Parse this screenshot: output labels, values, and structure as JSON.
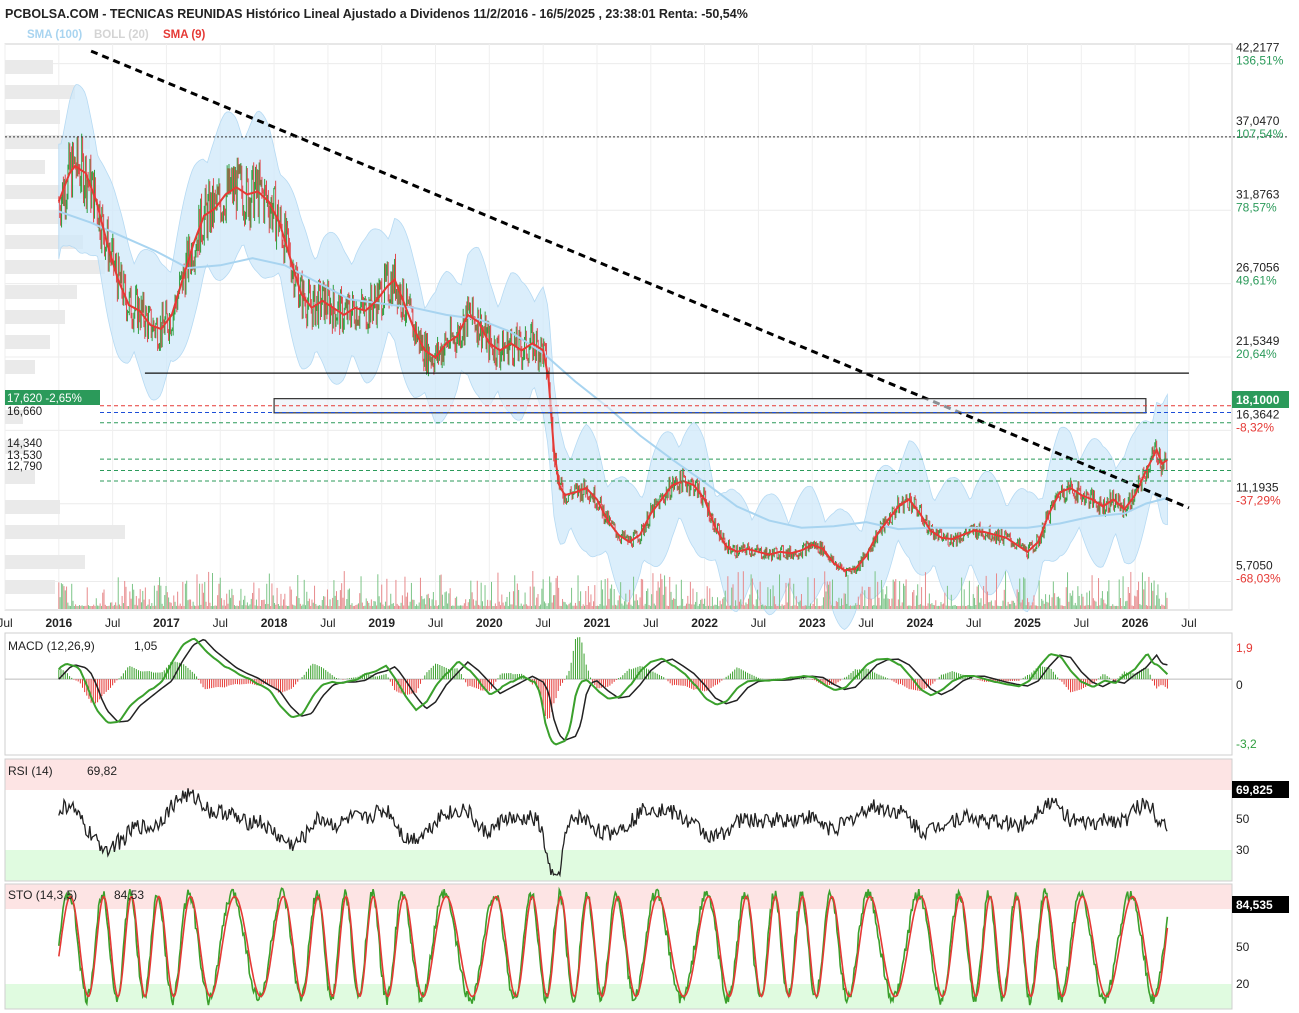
{
  "header": {
    "title": "PCBOLSA.COM - TECNICAS REUNIDAS Histórico Lineal Ajustado a Dividenos 11/2/2016 - 16/5/2025 , 23:38:01 Renta: -50,54%",
    "legend": [
      {
        "label": "SMA (100)",
        "color": "#a8d4f0"
      },
      {
        "label": "BOLL (20)",
        "color": "#d8d8d8"
      },
      {
        "label": "SMA (9)",
        "color": "#e53935"
      }
    ]
  },
  "colors": {
    "price_up": "#2e9e3e",
    "price_down": "#e0474c",
    "sma9": "#e53935",
    "sma100": "#a8d4f0",
    "boll_fill": "#cfe8fa",
    "trendline": "#000000",
    "green_label": "#2b9a5a",
    "red_label": "#e53935",
    "rsi_line": "#222222",
    "sto_k": "#3aa02c",
    "sto_d": "#e53935",
    "overbought": "#fde4e4",
    "oversold": "#e0fbe0"
  },
  "chart_data": [
    {
      "type": "line",
      "panel": "price",
      "x_tick_labels": [
        "Jul",
        "2016",
        "Jul",
        "2017",
        "Jul",
        "2018",
        "Jul",
        "2019",
        "Jul",
        "2020",
        "Jul",
        "2021",
        "Jul",
        "2022",
        "Jul",
        "2023",
        "Jul",
        "2024",
        "Jul",
        "2025",
        "Jul",
        "2026",
        "Jul"
      ],
      "y_axis_levels": [
        {
          "value": "42,2177",
          "pct": "136,51%",
          "pct_color": "green"
        },
        {
          "value": "37,0470",
          "pct": "107,54%",
          "pct_color": "green"
        },
        {
          "value": "31,8763",
          "pct": "78,57%",
          "pct_color": "green"
        },
        {
          "value": "26,7056",
          "pct": "49,61%",
          "pct_color": "green"
        },
        {
          "value": "21,5349",
          "pct": "20,64%",
          "pct_color": "green"
        },
        {
          "value": "16,3642",
          "pct": "-8,32%",
          "pct_color": "red"
        },
        {
          "value": "11,1935",
          "pct": "-37,29%",
          "pct_color": "red"
        },
        {
          "value": "5,7050",
          "pct": "-68,03%",
          "pct_color": "red"
        }
      ],
      "last_price": "18,1000",
      "left_labels": {
        "current": "17,620  -2,65%",
        "levels": [
          "16,660",
          "14,340",
          "13,530",
          "12,790"
        ]
      },
      "ylim": [
        3.7,
        43.6
      ],
      "series": [
        {
          "name": "SMA (9)",
          "values": [
            [
              2016.0,
              32.5
            ],
            [
              2016.05,
              33.5
            ],
            [
              2016.1,
              34.5
            ],
            [
              2016.15,
              35.0
            ],
            [
              2016.25,
              34.5
            ],
            [
              2016.35,
              32.5
            ],
            [
              2016.45,
              29.5
            ],
            [
              2016.55,
              27.0
            ],
            [
              2016.65,
              25.2
            ],
            [
              2016.75,
              24.8
            ],
            [
              2016.85,
              23.8
            ],
            [
              2016.95,
              23.5
            ],
            [
              2017.05,
              24.5
            ],
            [
              2017.15,
              27.0
            ],
            [
              2017.25,
              29.5
            ],
            [
              2017.35,
              31.5
            ],
            [
              2017.45,
              32.0
            ],
            [
              2017.55,
              33.0
            ],
            [
              2017.65,
              33.5
            ],
            [
              2017.75,
              33.0
            ],
            [
              2017.85,
              33.2
            ],
            [
              2017.95,
              32.5
            ],
            [
              2018.05,
              31.0
            ],
            [
              2018.15,
              28.5
            ],
            [
              2018.25,
              26.0
            ],
            [
              2018.35,
              25.0
            ],
            [
              2018.45,
              25.5
            ],
            [
              2018.55,
              25.0
            ],
            [
              2018.65,
              24.5
            ],
            [
              2018.75,
              25.0
            ],
            [
              2018.85,
              24.8
            ],
            [
              2018.95,
              25.5
            ],
            [
              2019.05,
              26.5
            ],
            [
              2019.12,
              27.0
            ],
            [
              2019.2,
              25.5
            ],
            [
              2019.3,
              23.5
            ],
            [
              2019.4,
              22.0
            ],
            [
              2019.5,
              21.5
            ],
            [
              2019.6,
              22.5
            ],
            [
              2019.7,
              23.0
            ],
            [
              2019.8,
              24.5
            ],
            [
              2019.9,
              24.0
            ],
            [
              2020.0,
              22.5
            ],
            [
              2020.1,
              22.0
            ],
            [
              2020.2,
              22.5
            ],
            [
              2020.3,
              22.0
            ],
            [
              2020.4,
              22.5
            ],
            [
              2020.5,
              22.0
            ],
            [
              2020.55,
              20.0
            ],
            [
              2020.6,
              15.0
            ],
            [
              2020.65,
              12.5
            ],
            [
              2020.7,
              11.8
            ],
            [
              2020.8,
              12.0
            ],
            [
              2020.9,
              12.3
            ],
            [
              2021.0,
              11.5
            ],
            [
              2021.1,
              10.0
            ],
            [
              2021.2,
              9.0
            ],
            [
              2021.3,
              8.5
            ],
            [
              2021.4,
              9.0
            ],
            [
              2021.5,
              10.5
            ],
            [
              2021.6,
              11.5
            ],
            [
              2021.7,
              12.5
            ],
            [
              2021.8,
              12.8
            ],
            [
              2021.9,
              12.5
            ],
            [
              2022.0,
              11.5
            ],
            [
              2022.1,
              9.5
            ],
            [
              2022.2,
              8.2
            ],
            [
              2022.3,
              7.8
            ],
            [
              2022.4,
              8.0
            ],
            [
              2022.5,
              7.8
            ],
            [
              2022.6,
              7.6
            ],
            [
              2022.7,
              7.8
            ],
            [
              2022.8,
              7.7
            ],
            [
              2022.9,
              7.9
            ],
            [
              2023.0,
              8.3
            ],
            [
              2023.1,
              8.0
            ],
            [
              2023.2,
              7.0
            ],
            [
              2023.3,
              6.5
            ],
            [
              2023.4,
              6.6
            ],
            [
              2023.5,
              7.5
            ],
            [
              2023.6,
              9.0
            ],
            [
              2023.7,
              10.0
            ],
            [
              2023.8,
              11.0
            ],
            [
              2023.9,
              11.5
            ],
            [
              2024.0,
              10.5
            ],
            [
              2024.1,
              9.3
            ],
            [
              2024.2,
              8.8
            ],
            [
              2024.3,
              8.7
            ],
            [
              2024.4,
              9.0
            ],
            [
              2024.5,
              9.3
            ],
            [
              2024.6,
              9.2
            ],
            [
              2024.7,
              9.0
            ],
            [
              2024.8,
              8.8
            ],
            [
              2024.9,
              8.3
            ],
            [
              2025.0,
              7.8
            ],
            [
              2025.1,
              8.5
            ],
            [
              2025.2,
              10.5
            ],
            [
              2025.3,
              12.0
            ],
            [
              2025.4,
              12.3
            ],
            [
              2025.5,
              11.8
            ],
            [
              2025.6,
              11.5
            ],
            [
              2025.7,
              11.0
            ],
            [
              2025.8,
              11.5
            ],
            [
              2025.9,
              10.8
            ],
            [
              2026.0,
              11.8
            ],
            [
              2026.1,
              13.5
            ],
            [
              2026.2,
              15.0
            ],
            [
              2026.25,
              14.0
            ],
            [
              2026.3,
              14.3
            ]
          ]
        },
        {
          "name": "SMA (100)",
          "values": [
            [
              2016.0,
              31.8
            ],
            [
              2016.3,
              31.0
            ],
            [
              2016.6,
              30.0
            ],
            [
              2016.9,
              29.0
            ],
            [
              2017.2,
              27.8
            ],
            [
              2017.5,
              28.0
            ],
            [
              2017.8,
              28.5
            ],
            [
              2018.1,
              28.0
            ],
            [
              2018.4,
              26.8
            ],
            [
              2018.7,
              25.6
            ],
            [
              2019.0,
              25.3
            ],
            [
              2019.3,
              25.0
            ],
            [
              2019.6,
              24.5
            ],
            [
              2019.9,
              24.2
            ],
            [
              2020.2,
              23.3
            ],
            [
              2020.5,
              21.8
            ],
            [
              2020.8,
              19.8
            ],
            [
              2021.1,
              18.0
            ],
            [
              2021.4,
              16.0
            ],
            [
              2021.7,
              14.3
            ],
            [
              2022.0,
              12.7
            ],
            [
              2022.3,
              11.0
            ],
            [
              2022.6,
              10.0
            ],
            [
              2022.9,
              9.5
            ],
            [
              2023.2,
              9.6
            ],
            [
              2023.5,
              9.9
            ],
            [
              2023.8,
              9.4
            ],
            [
              2024.1,
              9.5
            ],
            [
              2024.4,
              9.5
            ],
            [
              2024.7,
              9.5
            ],
            [
              2025.0,
              9.5
            ],
            [
              2025.3,
              9.8
            ],
            [
              2025.6,
              10.3
            ],
            [
              2025.9,
              10.5
            ],
            [
              2026.1,
              11.2
            ],
            [
              2026.3,
              11.6
            ]
          ]
        }
      ],
      "annotations": [
        {
          "kind": "trendline",
          "from": [
            2016.3,
            43.1
          ],
          "to": [
            2026.5,
            10.9
          ]
        },
        {
          "kind": "hline",
          "from": [
            2016.8,
            20.4
          ],
          "to": [
            2026.5,
            20.4
          ]
        },
        {
          "kind": "box",
          "x": [
            2018.0,
            2026.1
          ],
          "y": [
            17.6,
            18.6
          ]
        },
        {
          "kind": "dotted_hline",
          "y": 37.05
        }
      ]
    },
    {
      "type": "line",
      "panel": "macd",
      "label": "MACD (12,26,9)",
      "value": "1,05",
      "axis_labels": [
        "1,9",
        "0",
        "-3,2"
      ],
      "ylim": [
        -3.45,
        2.1
      ]
    },
    {
      "type": "line",
      "panel": "rsi",
      "label": "RSI (14)",
      "value": "69,82",
      "last_box": "69,825",
      "axis_labels": [
        "50",
        "30"
      ],
      "ylim": [
        20,
        80
      ],
      "bands": {
        "overbought": 70,
        "oversold": 30
      }
    },
    {
      "type": "line",
      "panel": "sto",
      "label": "STO (14,3,5)",
      "value": "84,53",
      "last_box": "84,535",
      "axis_labels": [
        "50",
        "20"
      ],
      "ylim": [
        0,
        100
      ],
      "bands": {
        "overbought": 80,
        "oversold": 20
      }
    }
  ]
}
